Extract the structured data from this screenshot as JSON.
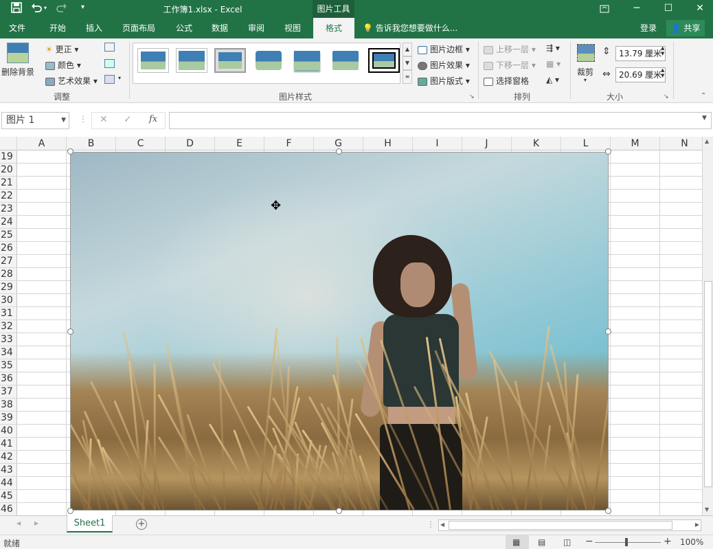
{
  "title_bar": {
    "window_title": "工作簿1.xlsx - Excel",
    "context_tab_group": "图片工具",
    "save_icon": "save-icon",
    "undo_icon": "undo-icon",
    "redo_icon": "redo-icon",
    "customize_icon": "customize-qat-icon",
    "ribbon_display_icon": "ribbon-display-icon",
    "minimize_icon": "minimize-icon",
    "maximize_icon": "maximize-icon",
    "close_icon": "close-icon"
  },
  "tabs": [
    "文件",
    "开始",
    "插入",
    "页面布局",
    "公式",
    "数据",
    "审阅",
    "视图",
    "格式"
  ],
  "active_tab": "格式",
  "tell_me": "告诉我您想要做什么...",
  "login": "登录",
  "share": "共享",
  "ribbon": {
    "adjust": {
      "remove_bg": "删除背景",
      "corrections": "更正",
      "color": "颜色",
      "artistic": "艺术效果",
      "label": "调整"
    },
    "picture_styles": {
      "border": "图片边框",
      "effects": "图片效果",
      "layout": "图片版式",
      "label": "图片样式"
    },
    "arrange": {
      "bring_forward": "上移一层",
      "send_backward": "下移一层",
      "selection_pane": "选择窗格",
      "label": "排列"
    },
    "size": {
      "crop": "裁剪",
      "height": "13.79 厘米",
      "width": "20.69 厘米",
      "label": "大小"
    }
  },
  "formula_bar": {
    "name_box": "图片 1",
    "cancel": "✕",
    "enter": "✓",
    "fx": "fx",
    "value": ""
  },
  "columns": [
    "A",
    "B",
    "C",
    "D",
    "E",
    "F",
    "G",
    "H",
    "I",
    "J",
    "K",
    "L",
    "M",
    "N"
  ],
  "rows": [
    "19",
    "20",
    "21",
    "22",
    "23",
    "24",
    "25",
    "26",
    "27",
    "28",
    "29",
    "30",
    "31",
    "32",
    "33",
    "34",
    "35",
    "36",
    "37",
    "38",
    "39",
    "40",
    "41",
    "42",
    "43",
    "44",
    "45",
    "46"
  ],
  "sheet_tabs": [
    "Sheet1"
  ],
  "status": {
    "ready": "就绪",
    "zoom": "100%"
  }
}
